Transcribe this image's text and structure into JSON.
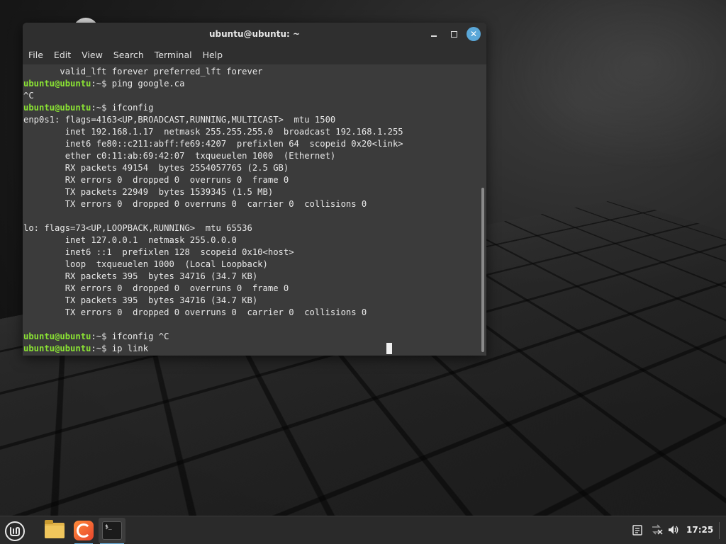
{
  "window": {
    "title": "ubuntu@ubuntu: ~",
    "menu": [
      "File",
      "Edit",
      "View",
      "Search",
      "Terminal",
      "Help"
    ]
  },
  "terminal": {
    "prompt": "ubuntu@ubuntu",
    "prompt_suffix": ":~$ ",
    "lines": [
      {
        "type": "out",
        "text": "       valid_lft forever preferred_lft forever"
      },
      {
        "type": "cmd",
        "text": "ping google.ca"
      },
      {
        "type": "out",
        "text": "^C"
      },
      {
        "type": "cmd",
        "text": "ifconfig"
      },
      {
        "type": "out",
        "text": "enp0s1: flags=4163<UP,BROADCAST,RUNNING,MULTICAST>  mtu 1500"
      },
      {
        "type": "out",
        "text": "        inet 192.168.1.17  netmask 255.255.255.0  broadcast 192.168.1.255"
      },
      {
        "type": "out",
        "text": "        inet6 fe80::c211:abff:fe69:4207  prefixlen 64  scopeid 0x20<link>"
      },
      {
        "type": "out",
        "text": "        ether c0:11:ab:69:42:07  txqueuelen 1000  (Ethernet)"
      },
      {
        "type": "out",
        "text": "        RX packets 49154  bytes 2554057765 (2.5 GB)"
      },
      {
        "type": "out",
        "text": "        RX errors 0  dropped 0  overruns 0  frame 0"
      },
      {
        "type": "out",
        "text": "        TX packets 22949  bytes 1539345 (1.5 MB)"
      },
      {
        "type": "out",
        "text": "        TX errors 0  dropped 0 overruns 0  carrier 0  collisions 0"
      },
      {
        "type": "out",
        "text": ""
      },
      {
        "type": "out",
        "text": "lo: flags=73<UP,LOOPBACK,RUNNING>  mtu 65536"
      },
      {
        "type": "out",
        "text": "        inet 127.0.0.1  netmask 255.0.0.0"
      },
      {
        "type": "out",
        "text": "        inet6 ::1  prefixlen 128  scopeid 0x10<host>"
      },
      {
        "type": "out",
        "text": "        loop  txqueuelen 1000  (Local Loopback)"
      },
      {
        "type": "out",
        "text": "        RX packets 395  bytes 34716 (34.7 KB)"
      },
      {
        "type": "out",
        "text": "        RX errors 0  dropped 0  overruns 0  frame 0"
      },
      {
        "type": "out",
        "text": "        TX packets 395  bytes 34716 (34.7 KB)"
      },
      {
        "type": "out",
        "text": "        TX errors 0  dropped 0 overruns 0  carrier 0  collisions 0"
      },
      {
        "type": "out",
        "text": ""
      },
      {
        "type": "cmd",
        "text": "ifconfig ^C"
      },
      {
        "type": "cmd",
        "text": "ip link"
      }
    ]
  },
  "taskbar": {
    "term_icon_text": "$_",
    "clock": "17:25"
  },
  "colors": {
    "prompt": "#8ae234",
    "close_button": "#5aa7d8",
    "terminal_bg": "#3b3b3b"
  },
  "icons": {
    "menu": "linux-mint-logo-icon",
    "files": "folder-icon",
    "browser": "firefox-icon",
    "terminal": "terminal-icon",
    "notes": "notes-icon",
    "network": "network-disconnected-icon",
    "volume": "volume-icon"
  }
}
